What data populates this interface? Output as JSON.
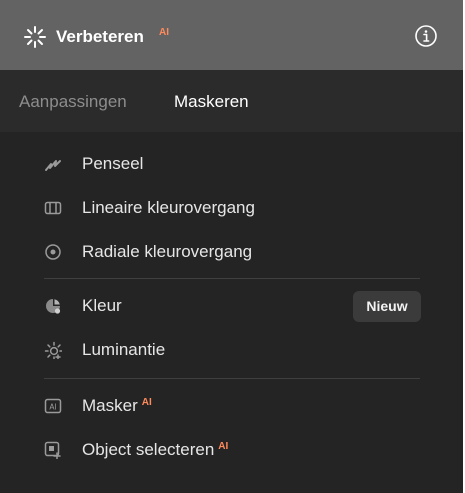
{
  "header": {
    "title": "Verbeteren",
    "ai_badge": "AI",
    "icon": "sparkle-icon",
    "info_icon": "info-icon"
  },
  "tabs": [
    {
      "label": "Aanpassingen",
      "active": false
    },
    {
      "label": "Maskeren",
      "active": true
    }
  ],
  "groups": [
    [
      {
        "label": "Penseel",
        "icon": "brush-icon"
      },
      {
        "label": "Lineaire kleurovergang",
        "icon": "linear-gradient-icon"
      },
      {
        "label": "Radiale kleurovergang",
        "icon": "radial-gradient-icon"
      }
    ],
    [
      {
        "label": "Kleur",
        "icon": "color-icon",
        "badge": "Nieuw"
      },
      {
        "label": "Luminantie",
        "icon": "luminance-icon"
      }
    ],
    [
      {
        "label": "Masker",
        "icon": "ai-mask-icon",
        "ai": "AI"
      },
      {
        "label": "Object selecteren",
        "icon": "select-object-icon",
        "ai": "AI"
      }
    ]
  ],
  "colors": {
    "accent": "#ff8a5c",
    "panel": "#242424",
    "header": "#636363"
  }
}
